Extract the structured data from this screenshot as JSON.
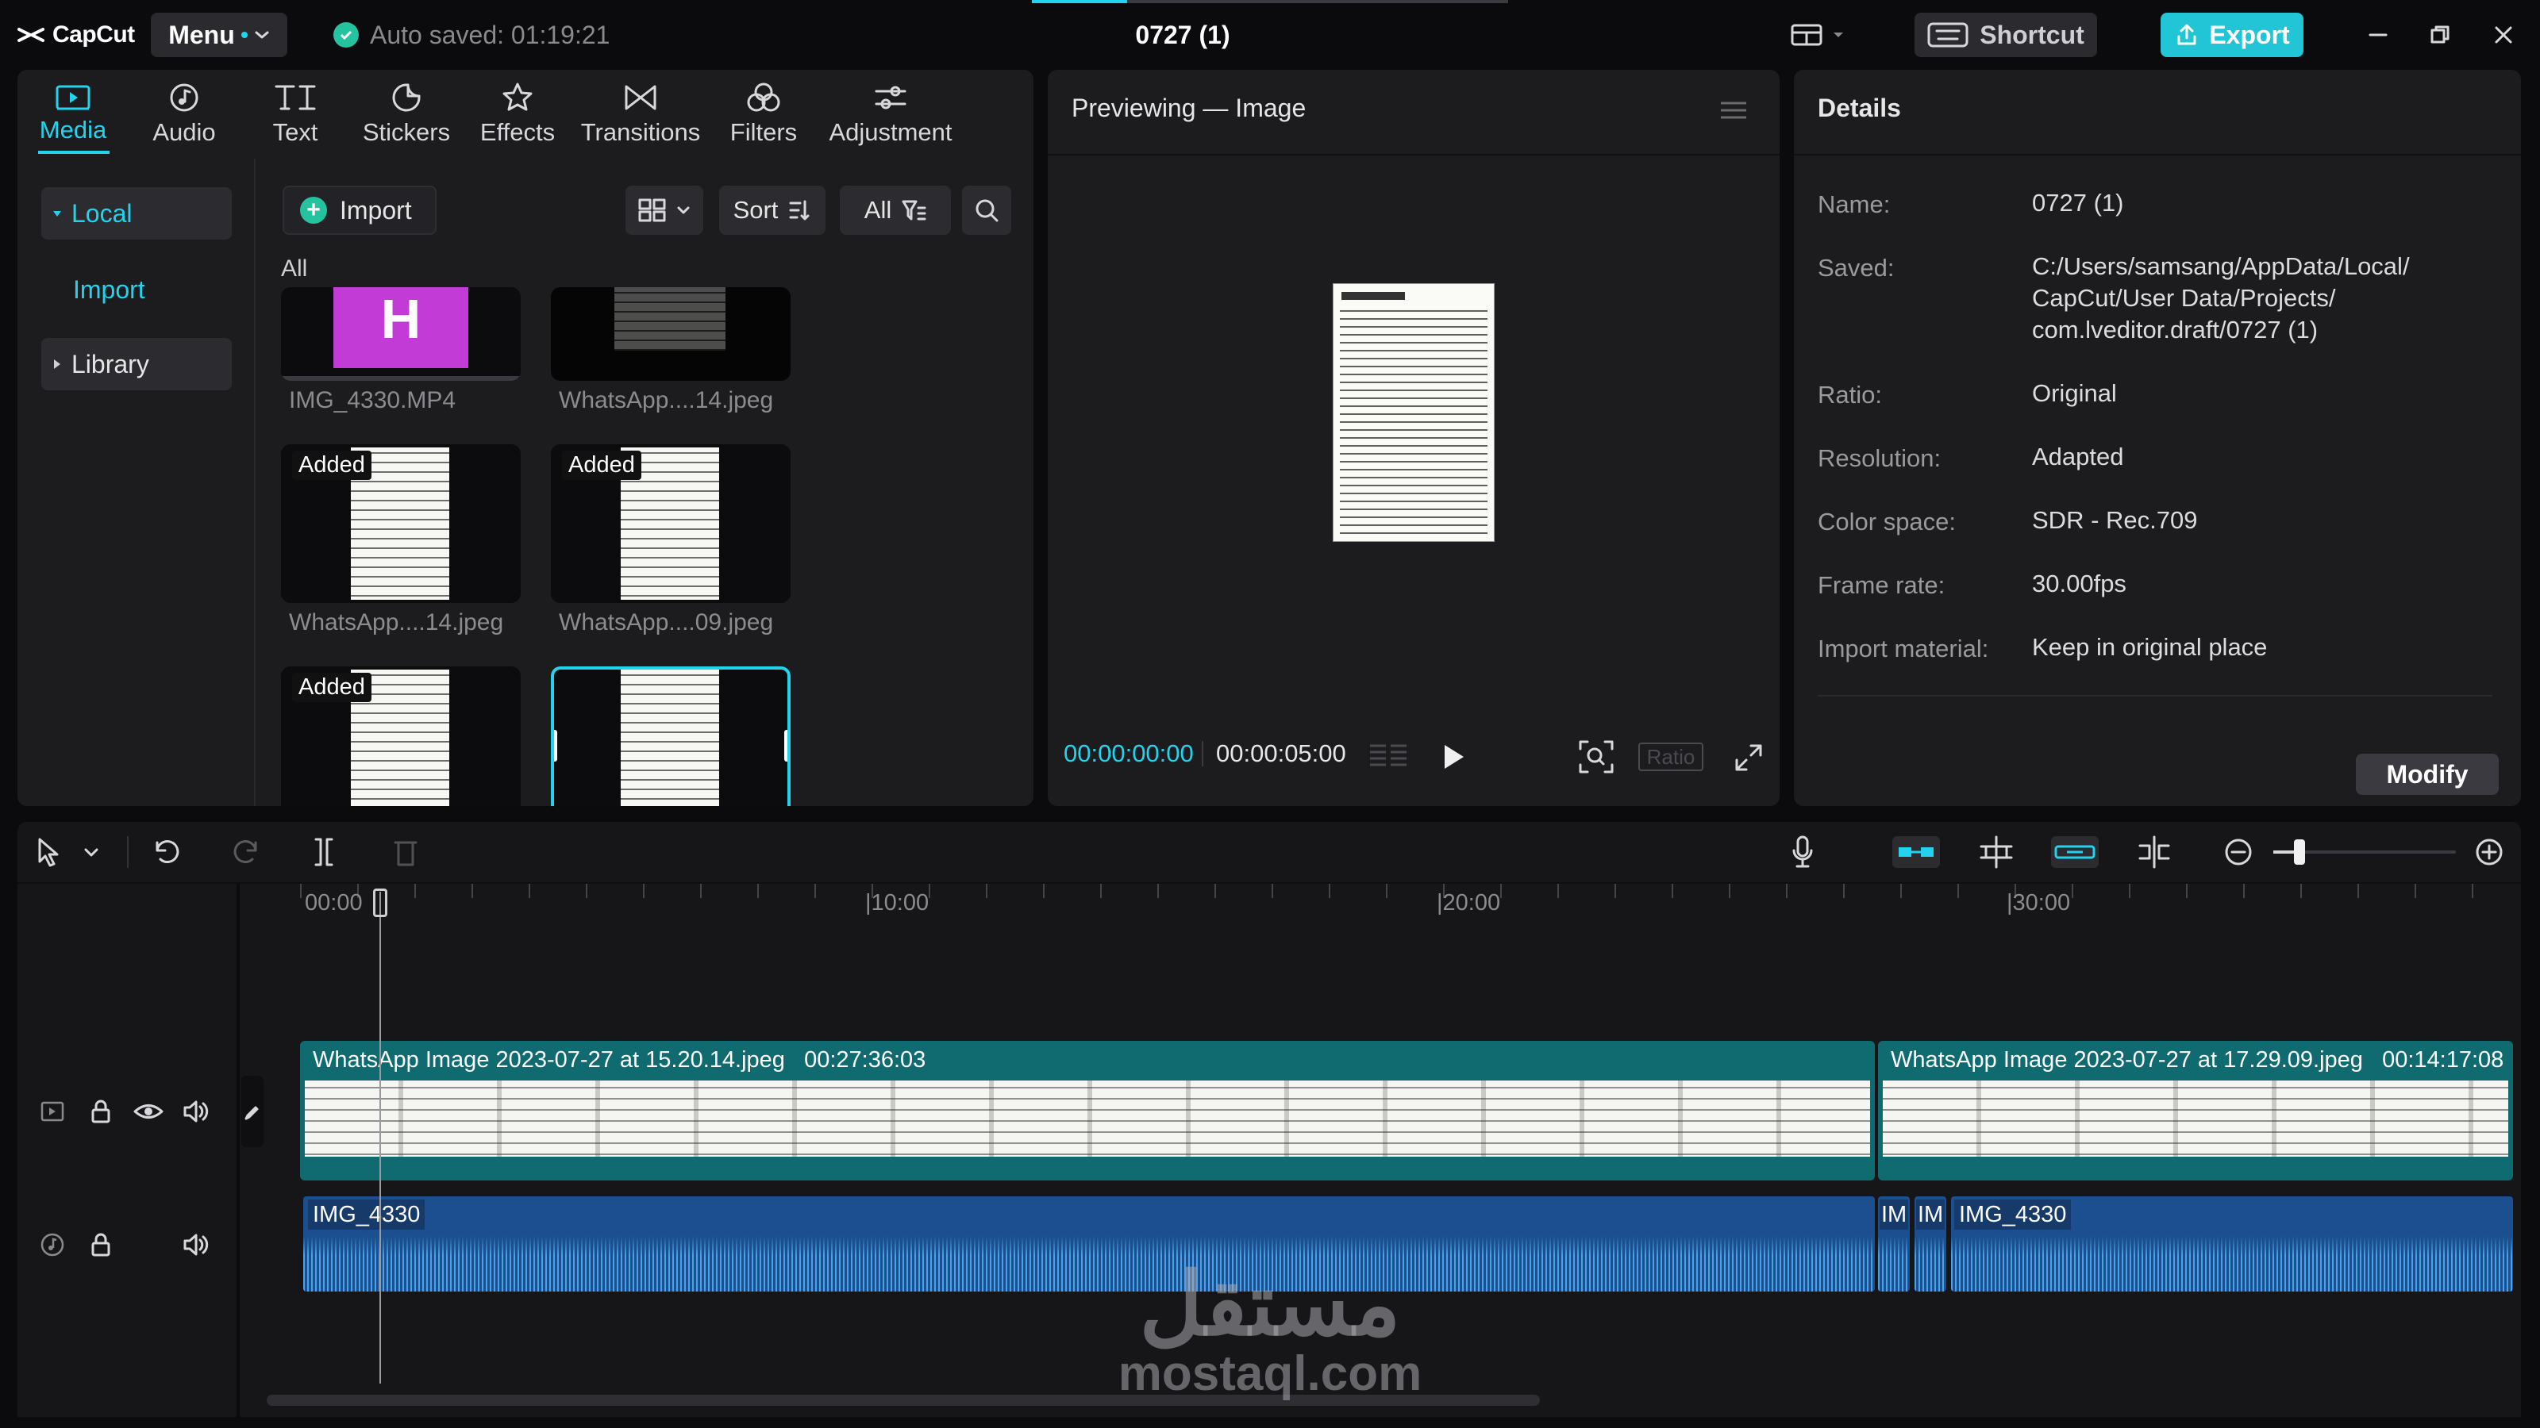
{
  "app": {
    "logo": "CapCut",
    "menu_label": "Menu",
    "autosave": "Auto saved: 01:19:21",
    "project_title": "0727 (1)",
    "shortcut_label": "Shortcut",
    "export_label": "Export"
  },
  "media_tabs": [
    {
      "label": "Media",
      "icon": "media-icon",
      "active": true
    },
    {
      "label": "Audio",
      "icon": "audio-icon"
    },
    {
      "label": "Text",
      "icon": "text-icon"
    },
    {
      "label": "Stickers",
      "icon": "stickers-icon"
    },
    {
      "label": "Effects",
      "icon": "effects-icon"
    },
    {
      "label": "Transitions",
      "icon": "transitions-icon"
    },
    {
      "label": "Filters",
      "icon": "filters-icon"
    },
    {
      "label": "Adjustment",
      "icon": "adjustment-icon"
    }
  ],
  "media_side": {
    "local": "Local",
    "import": "Import",
    "library": "Library"
  },
  "media_toolbar": {
    "import": "Import",
    "sort": "Sort",
    "filter": "All",
    "section_label": "All"
  },
  "media_items": [
    {
      "name": "IMG_4330.MP4",
      "added": ""
    },
    {
      "name": "WhatsApp....14.jpeg",
      "added": ""
    },
    {
      "name": "WhatsApp....14.jpeg",
      "added": "Added"
    },
    {
      "name": "WhatsApp....09.jpeg",
      "added": "Added"
    },
    {
      "name": "",
      "added": "Added"
    },
    {
      "name": "",
      "added": ""
    }
  ],
  "video_thumb_letter": "H",
  "preview": {
    "title": "Previewing — Image",
    "current_time": "00:00:00:00",
    "total_time": "00:00:05:00",
    "ratio_label": "Ratio"
  },
  "details": {
    "title": "Details",
    "rows": [
      {
        "key": "Name:",
        "value": "0727 (1)"
      },
      {
        "key": "Saved:",
        "value": "C:/Users/samsang/AppData/Local/ CapCut/User Data/Projects/ com.lveditor.draft/0727 (1)"
      },
      {
        "key": "Ratio:",
        "value": "Original"
      },
      {
        "key": "Resolution:",
        "value": "Adapted"
      },
      {
        "key": "Color space:",
        "value": "SDR - Rec.709"
      },
      {
        "key": "Frame rate:",
        "value": "30.00fps"
      },
      {
        "key": "Import material:",
        "value": "Keep in original place"
      }
    ],
    "modify_label": "Modify"
  },
  "timeline": {
    "ruler": [
      "00:00",
      "|10:00",
      "|20:00",
      "|30:00"
    ],
    "video_clips": [
      {
        "name": "WhatsApp Image 2023-07-27 at 15.20.14.jpeg",
        "duration": "00:27:36:03"
      },
      {
        "name": "WhatsApp Image 2023-07-27 at 17.29.09.jpeg",
        "duration": "00:14:17:08"
      }
    ],
    "audio_clips": [
      {
        "name": "IMG_4330"
      },
      {
        "name": "IM"
      },
      {
        "name": "IM"
      },
      {
        "name": "IMG_4330"
      }
    ]
  },
  "watermark": {
    "arabic": "مستقل",
    "domain": "mostaql.com"
  },
  "colors": {
    "accent": "#22d3ee",
    "export": "#22c5d6",
    "video_clip": "#0f6b70",
    "audio_clip": "#1b4f8f"
  }
}
